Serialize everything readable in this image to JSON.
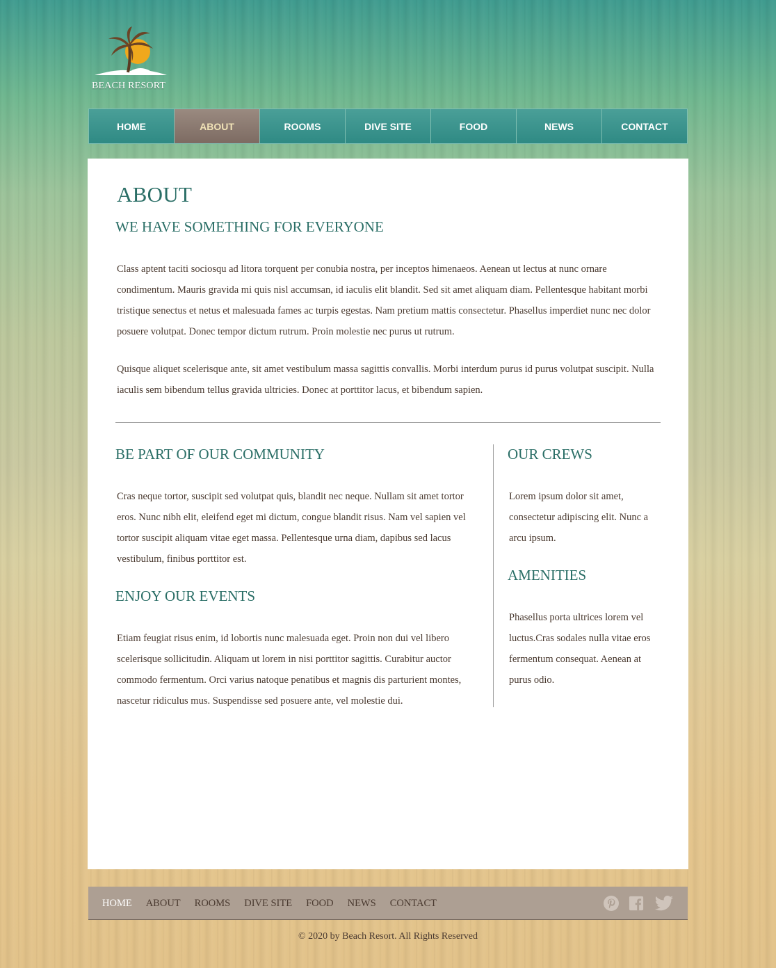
{
  "brand": {
    "name": "BEACH RESORT",
    "logo_icon": "palm-tree-sun-icon"
  },
  "nav": {
    "items": [
      {
        "label": "HOME"
      },
      {
        "label": "ABOUT",
        "active": true
      },
      {
        "label": "ROOMS"
      },
      {
        "label": "DIVE SITE"
      },
      {
        "label": "FOOD"
      },
      {
        "label": "NEWS"
      },
      {
        "label": "CONTACT"
      }
    ]
  },
  "colors": {
    "accent": "#2a6e66",
    "nav_bg": "#3a948d",
    "nav_active": "#8b7a70",
    "footer_bg": "#ad9f93"
  },
  "page": {
    "title": "ABOUT",
    "intro_heading": "WE HAVE SOMETHING FOR EVERYONE",
    "intro_p1": "Class aptent taciti sociosqu ad litora torquent per conubia nostra, per inceptos himenaeos. Aenean ut lectus at nunc ornare condimentum. Mauris gravida mi quis nisl accumsan, id iaculis elit blandit. Sed sit amet aliquam diam. Pellentesque habitant morbi tristique senectus et netus et malesuada fames ac turpis egestas. Nam pretium mattis consectetur. Phasellus imperdiet nunc nec dolor posuere volutpat. Donec tempor dictum rutrum. Proin molestie nec purus ut rutrum.",
    "intro_p2": "Quisque aliquet scelerisque ante, sit amet vestibulum massa sagittis convallis. Morbi interdum purus id purus volutpat suscipit. Nulla iaculis sem bibendum tellus gravida ultricies. Donec at porttitor lacus, et bibendum sapien.",
    "community_heading": "BE PART OF OUR COMMUNITY",
    "community_text": "Cras neque tortor, suscipit sed volutpat quis, blandit nec neque. Nullam sit amet tortor eros. Nunc nibh elit, eleifend eget mi dictum, congue blandit risus. Nam vel sapien vel tortor suscipit aliquam vitae eget massa. Pellentesque urna diam, dapibus sed lacus vestibulum, finibus porttitor est.",
    "events_heading": "ENJOY OUR EVENTS",
    "events_text": "Etiam feugiat risus enim, id lobortis nunc malesuada eget. Proin non dui vel libero scelerisque sollicitudin. Aliquam ut lorem in nisi porttitor sagittis. Curabitur auctor commodo fermentum. Orci varius natoque penatibus et magnis dis parturient montes, nascetur ridiculus mus. Suspendisse sed posuere ante, vel molestie dui.",
    "crews_heading": "OUR CREWS",
    "crews_text": "Lorem ipsum dolor sit amet, consectetur adipiscing elit. Nunc a arcu ipsum.",
    "amenities_heading": "AMENITIES",
    "amenities_text": "Phasellus porta ultrices lorem vel luctus.Cras sodales nulla vitae eros fermentum consequat. Aenean at purus odio."
  },
  "footer": {
    "links": [
      {
        "label": "HOME",
        "active": true
      },
      {
        "label": "ABOUT"
      },
      {
        "label": "ROOMS"
      },
      {
        "label": "DIVE SITE"
      },
      {
        "label": "FOOD"
      },
      {
        "label": "NEWS"
      },
      {
        "label": "CONTACT"
      }
    ],
    "social_icons": [
      "pinterest-icon",
      "facebook-icon",
      "twitter-icon"
    ],
    "copyright": "© 2020 by Beach Resort. All Rights Reserved"
  }
}
